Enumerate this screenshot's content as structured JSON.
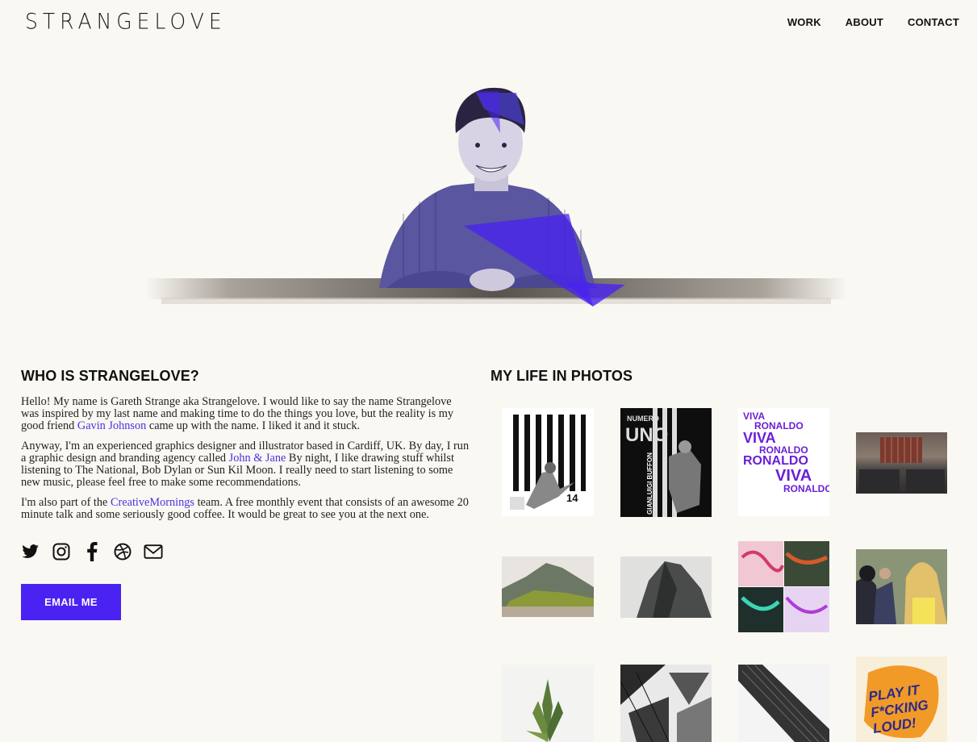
{
  "header": {
    "logo": "STRANGELOVE",
    "nav": [
      "WORK",
      "ABOUT",
      "CONTACT"
    ]
  },
  "about": {
    "heading": "WHO IS STRANGELOVE?",
    "p1_before": "Hello! My name is Gareth Strange aka Strangelove. I would like to say the name Strangelove was inspired by my last name and making time to do the things you love, but the reality is my good friend ",
    "p1_link": "Gavin Johnson",
    "p1_after": " came up with the name. I liked it and it stuck.",
    "p2_before": "Anyway, I'm an experienced graphics designer and illustrator based in Cardiff, UK. By day, I run a graphic design and branding agency called ",
    "p2_link": "John & Jane",
    "p2_after": " By night, I like drawing stuff whilst listening to The National, Bob Dylan or Sun Kil Moon. I really need to start listening to some new music, please feel free to make some recommendations.",
    "p3_before": "I'm also part of the ",
    "p3_link": "CreativeMornings",
    "p3_after": " team. A free monthly event that consists of an awesome 20 minute talk and some seriously good coffee. It would be great to see you at the next one.",
    "social_icons": [
      "twitter-icon",
      "instagram-icon",
      "facebook-icon",
      "dribbble-icon",
      "mail-icon"
    ],
    "email_button": "EMAIL ME"
  },
  "photos": {
    "heading": "MY LIFE IN PHOTOS",
    "poster1_number": "14",
    "poster2_top": "NUMERO",
    "poster2_big": "UNO",
    "poster2_name": "GIANLUIGI BUFFON",
    "poster3_lines": [
      "VIVA",
      "RONALDO",
      "VIVA",
      "RONALDO",
      "RONALDO",
      "VIVA",
      "RONALDO"
    ],
    "poster4_text": [
      "PLAY IT",
      "F*CKING",
      "LOUD!"
    ]
  },
  "colors": {
    "accent": "#4a22f2",
    "link": "#4a32e0",
    "background": "#faf8f3"
  }
}
